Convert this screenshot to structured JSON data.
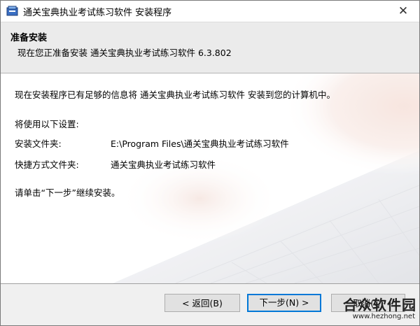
{
  "window": {
    "title": "通关宝典执业考试练习软件 安装程序",
    "close_glyph": "✕"
  },
  "header": {
    "title": "准备安装",
    "subtitle": "现在您正准备安装 通关宝典执业考试练习软件 6.3.802"
  },
  "content": {
    "intro": "现在安装程序已有足够的信息将 通关宝典执业考试练习软件 安装到您的计算机中。",
    "settings_heading": "将使用以下设置:",
    "install_folder_label": "安装文件夹:",
    "install_folder_value": "E:\\Program Files\\通关宝典执业考试练习软件",
    "shortcut_folder_label": "快捷方式文件夹:",
    "shortcut_folder_value": "通关宝典执业考试练习软件",
    "instruction": "请单击“下一步”继续安装。"
  },
  "buttons": {
    "back": "< 返回(B)",
    "next": "下一步(N) >",
    "cancel": "取消(C)"
  },
  "watermark": {
    "name": "合众软件园",
    "url": "www.hezhong.net"
  },
  "icons": {
    "app": "installer-box-icon",
    "close": "close-icon"
  }
}
